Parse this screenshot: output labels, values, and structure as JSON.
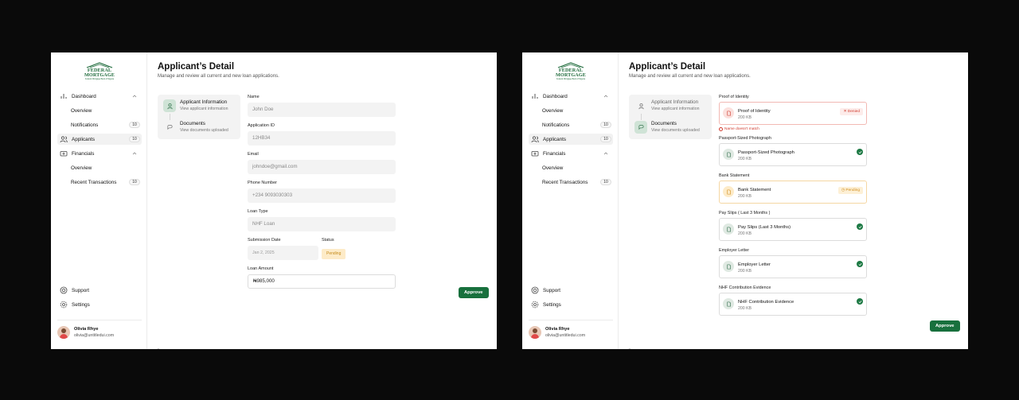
{
  "brand": {
    "line1": "FEDERAL",
    "line2": "MORTGAGE",
    "line3": "Federal Mortgage Bank of Nigeria"
  },
  "sidebar": {
    "dashboard": "Dashboard",
    "overview": "Overview",
    "notifications": "Notifications",
    "notifications_count": "10",
    "applicants": "Applicants",
    "applicants_count": "10",
    "financials": "Financials",
    "fin_overview": "Overview",
    "recent_transactions": "Recent Transactions",
    "recent_transactions_count": "10",
    "support": "Support",
    "settings": "Settings"
  },
  "user": {
    "name": "Olivia Rhye",
    "email": "olivia@untitledui.com"
  },
  "page": {
    "title": "Applicant’s Detail",
    "subtitle": "Manage and review all current and new loan applications."
  },
  "steps": [
    {
      "title": "Applicant Information",
      "desc": "View applicant information"
    },
    {
      "title": "Documents",
      "desc": "View documents uploaded"
    }
  ],
  "form": {
    "name_label": "Name",
    "name_value": "John Doe",
    "appid_label": "Application ID",
    "appid_value": "12HB34",
    "email_label": "Email",
    "email_value": "johndoe@gmail.com",
    "phone_label": "Phone Number",
    "phone_value": "+234 9093030303",
    "loantype_label": "Loan Type",
    "loantype_value": "NHF Loan",
    "date_label": "Submission Date",
    "date_value": "Jan 2, 2025",
    "status_label": "Status",
    "status_value": "Pending",
    "amount_label": "Loan Amount",
    "amount_value": "₦985,000"
  },
  "documents": {
    "proof_label": "Proof of Identity",
    "proof_name": "Proof of Identity",
    "proof_size": "200 KB",
    "proof_status": "Denied",
    "proof_error": "Name doesn't match",
    "passport_label": "Passport-Sized Photograph",
    "passport_name": "Passport-Sized Photograph",
    "passport_size": "200 KB",
    "bank_label": "Bank Statement",
    "bank_name": "Bank Statement",
    "bank_size": "200 KB",
    "bank_status": "Pending",
    "payslip_label": "Pay Slips ( Last 3 Months )",
    "payslip_name": "Pay Slips (Last 3 Months)",
    "payslip_size": "200 KB",
    "employer_label": "Employer Letter",
    "employer_name": "Employer Letter",
    "employer_size": "200 KB",
    "nhf_label": "NHF Contribution Evidence",
    "nhf_name": "NHF Contribution Evidence",
    "nhf_size": "200 KB"
  },
  "actions": {
    "approve": "Approve"
  },
  "colors": {
    "accent": "#18703d",
    "denied": "#d03b2e",
    "pending": "#d18d1c",
    "background": "#0a0a0a"
  },
  "icons": {
    "dashboard": "bar-chart-icon",
    "applicants": "users-icon",
    "financials": "wallet-icon",
    "support": "life-buoy-icon",
    "settings": "gear-icon",
    "logout": "logout-icon",
    "step_info": "user-icon",
    "step_docs": "chat-icon",
    "doc": "file-icon",
    "approved": "check-circle-icon"
  }
}
